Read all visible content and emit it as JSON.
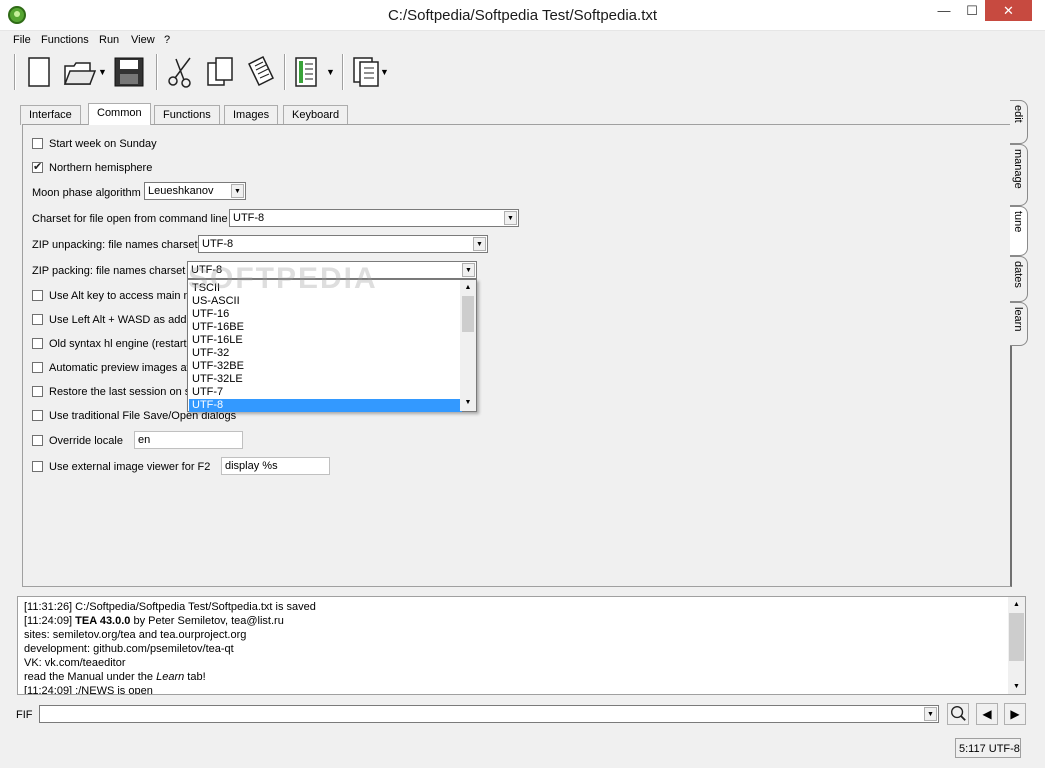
{
  "window": {
    "title": "C:/Softpedia/Softpedia Test/Softpedia.txt",
    "min": "—",
    "max": "☐",
    "close": "✕"
  },
  "menu": [
    "File",
    "Functions",
    "Run",
    "View",
    "?"
  ],
  "tabs": [
    "Interface",
    "Common",
    "Functions",
    "Images",
    "Keyboard"
  ],
  "active_tab": "Common",
  "side_tabs": [
    "edit",
    "manage",
    "tune",
    "dates",
    "learn"
  ],
  "active_side_tab": "tune",
  "options": {
    "start_week_sunday": {
      "label": "Start week on Sunday",
      "checked": false
    },
    "northern_hemisphere": {
      "label": "Northern hemisphere",
      "checked": true
    },
    "moon_phase": {
      "label": "Moon phase algorithm",
      "value": "Leueshkanov"
    },
    "charset_cmdline": {
      "label": "Charset for file open from command line",
      "value": "UTF-8"
    },
    "zip_unpacking": {
      "label": "ZIP unpacking: file names charset",
      "value": "UTF-8"
    },
    "zip_packing": {
      "label": "ZIP packing: file names charset",
      "value": "UTF-8"
    },
    "alt_key_menu": {
      "label": "Use Alt key to access main m"
    },
    "left_alt_wasd": {
      "label": "Use Left Alt + WASD as addi"
    },
    "old_syntax": {
      "label": "Old syntax hl engine (restart"
    },
    "auto_preview": {
      "label": "Automatic preview images at"
    },
    "restore_session": {
      "label": "Restore the last session on s"
    },
    "traditional_dialogs": {
      "label": "Use traditional File Save/Open dialogs"
    },
    "override_locale": {
      "label": "Override locale",
      "value": "en"
    },
    "external_viewer": {
      "label": "Use external image viewer for F2",
      "value": "display %s"
    }
  },
  "dropdown_items": [
    "TSCII",
    "US-ASCII",
    "UTF-16",
    "UTF-16BE",
    "UTF-16LE",
    "UTF-32",
    "UTF-32BE",
    "UTF-32LE",
    "UTF-7",
    "UTF-8"
  ],
  "dropdown_selected": "UTF-8",
  "watermark": "SOFTPEDIA",
  "log": {
    "l1": "[11:31:26] C:/Softpedia/Softpedia Test/Softpedia.txt is saved",
    "l2_time": "[11:24:09] ",
    "l2_bold": "TEA 43.0.0",
    "l2_rest": " by Peter Semiletov, tea@list.ru",
    "l3": "sites: semiletov.org/tea and tea.ourproject.org",
    "l4": "development: github.com/psemiletov/tea-qt",
    "l5": "VK: vk.com/teaeditor",
    "l6_pre": "read the Manual under the ",
    "l6_em": "Learn",
    "l6_post": " tab!",
    "l7": "[11:24:09] :/NEWS is open"
  },
  "fif": {
    "label": "FIF",
    "value": ""
  },
  "status": "5:117 UTF-8",
  "colors": {
    "selection": "#3399ff",
    "close_button": "#c74a40"
  }
}
